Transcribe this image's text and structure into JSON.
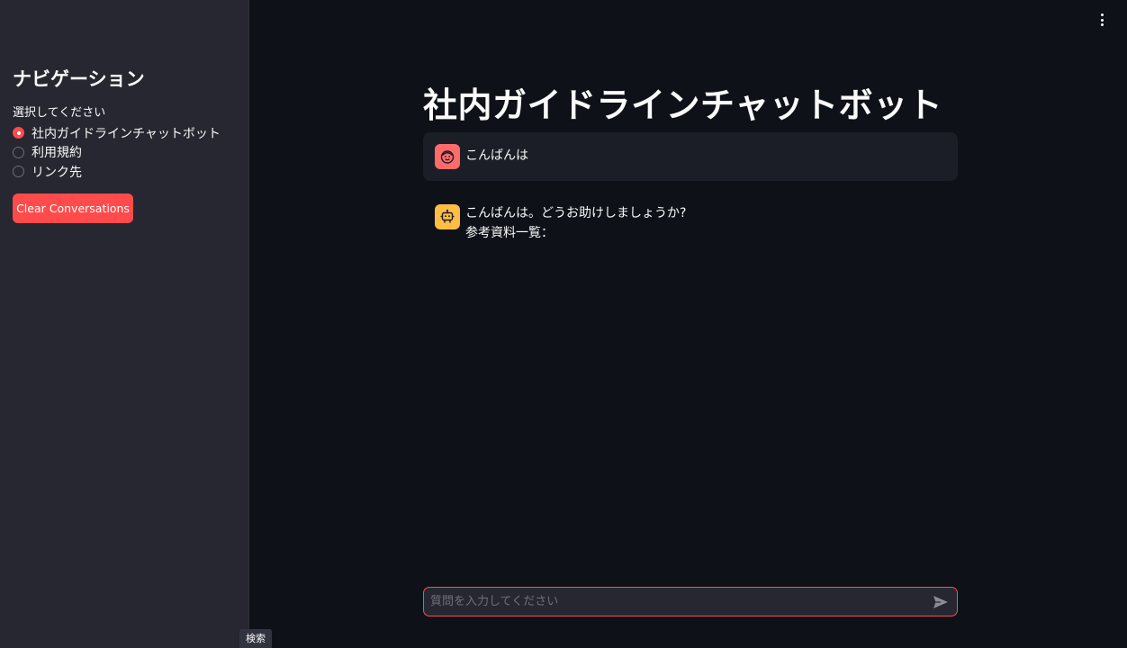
{
  "sidebar": {
    "title": "ナビゲーション",
    "radio_label": "選択してください",
    "options": [
      {
        "label": "社内ガイドラインチャットボット",
        "selected": true
      },
      {
        "label": "利用規約",
        "selected": false
      },
      {
        "label": "リンク先",
        "selected": false
      }
    ],
    "clear_button": "Clear Conversations",
    "search_tab": "検索"
  },
  "main": {
    "title": "社内ガイドラインチャットボット",
    "messages": [
      {
        "role": "user",
        "avatar_icon": "smiley-face-icon",
        "lines": [
          "こんばんは"
        ]
      },
      {
        "role": "assistant",
        "avatar_icon": "robot-icon",
        "lines": [
          "こんばんは。どうお助けしましょうか?",
          "参考資料一覧："
        ]
      }
    ],
    "chat_input": {
      "placeholder": "質問を入力してください",
      "send_icon": "send-arrow-icon"
    },
    "menu_icon": "vertical-ellipsis-icon"
  },
  "colors": {
    "accent": "#ff4b4b",
    "background": "#0e1117",
    "sidebar_background": "#262730",
    "user_avatar": "#ff6b6b",
    "assistant_avatar": "#ffbd45"
  }
}
